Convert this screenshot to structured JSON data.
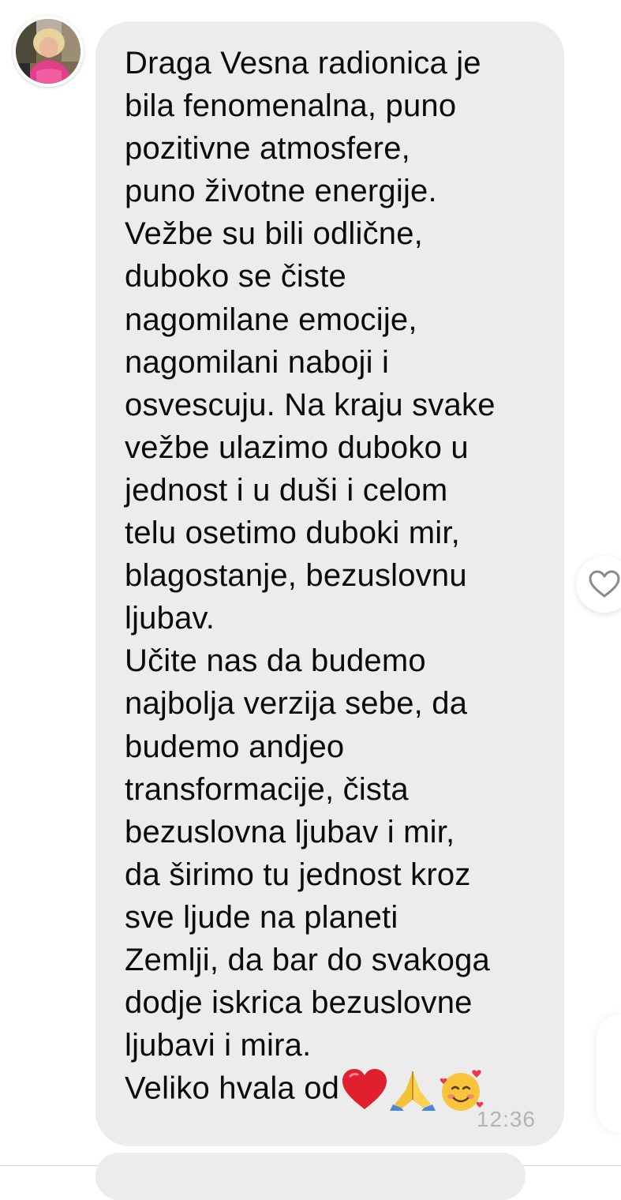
{
  "message": {
    "lines": [
      "Draga Vesna radionica je",
      "bila fenomenalna, puno",
      "pozitivne atmosfere,",
      "puno životne energije.",
      "Vežbe su bili odlične,",
      "duboko se čiste",
      "nagomilane emocije,",
      "nagomilani naboji i",
      "osvescuju. Na kraju svake",
      "vežbe ulazimo duboko u",
      "jednost i u duši i celom",
      "telu osetimo duboki mir,",
      "blagostanje, bezuslovnu",
      "ljubav.",
      "Učite nas da budemo",
      "najbolja verzija sebe, da",
      "budemo andjeo",
      "transformacije, čista",
      "bezuslovna ljubav i mir,",
      "da širimo tu jednost kroz",
      "sve ljude na planeti",
      "Zemlji, da bar do svakoga",
      "dodje iskrica bezuslovne",
      "ljubavi i mira."
    ],
    "last_line": "Veliko hvala od",
    "emojis": [
      "red-heart",
      "folded-hands",
      "smiling-face-with-hearts"
    ],
    "timestamp": "12:36"
  },
  "colors": {
    "bubble": "#ececed",
    "text": "#0b0b0b",
    "timestamp": "#b4b4b8",
    "heart": "#e0202e"
  },
  "icons": {
    "reaction": "heart-outline-icon",
    "avatar": "user-avatar"
  }
}
